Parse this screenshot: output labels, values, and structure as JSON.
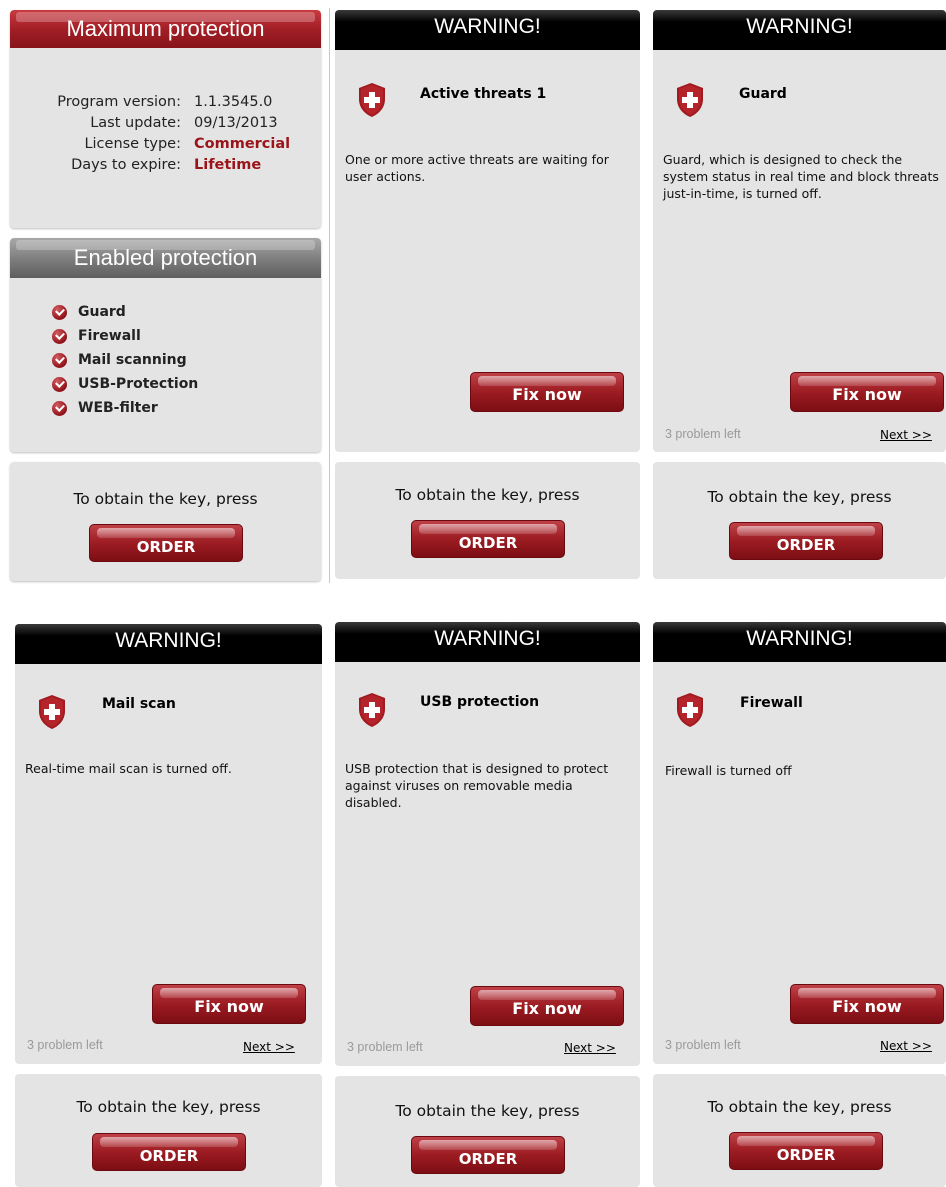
{
  "info": {
    "title": "Maximum protection",
    "rows": [
      {
        "label": "Program version:",
        "value": "1.1.3545.0"
      },
      {
        "label": "Last update:",
        "value": "09/13/2013"
      },
      {
        "label": "License type:",
        "value": "Commercial"
      },
      {
        "label": "Days to expire:",
        "value": "Lifetime"
      }
    ]
  },
  "enabled": {
    "title": "Enabled protection",
    "items": [
      "Guard",
      "Firewall",
      "Mail scanning",
      "USB-Protection",
      "WEB-filter"
    ]
  },
  "key": {
    "text": "To obtain the key, press",
    "order_label": "ORDER"
  },
  "common": {
    "warning_title": "WARNING!",
    "fix_label": "Fix now",
    "problems_left": "3 problem left",
    "next_label": "Next >>"
  },
  "warnings": [
    {
      "title": "Active threats 1",
      "description": "One or more active threats are waiting for user actions."
    },
    {
      "title": "Guard",
      "description": "Guard, which is designed to check the system status in real time and block threats just-in-time, is turned off."
    },
    {
      "title": "Mail scan",
      "description": "Real-time mail scan is turned off."
    },
    {
      "title": "USB protection",
      "description": "USB protection that is designed to protect against viruses on removable media disabled."
    },
    {
      "title": "Firewall",
      "description": "Firewall is turned off"
    }
  ],
  "colors": {
    "accent_red": "#9a1419",
    "panel_bg": "#e4e4e4",
    "warning_header": "#000000"
  }
}
